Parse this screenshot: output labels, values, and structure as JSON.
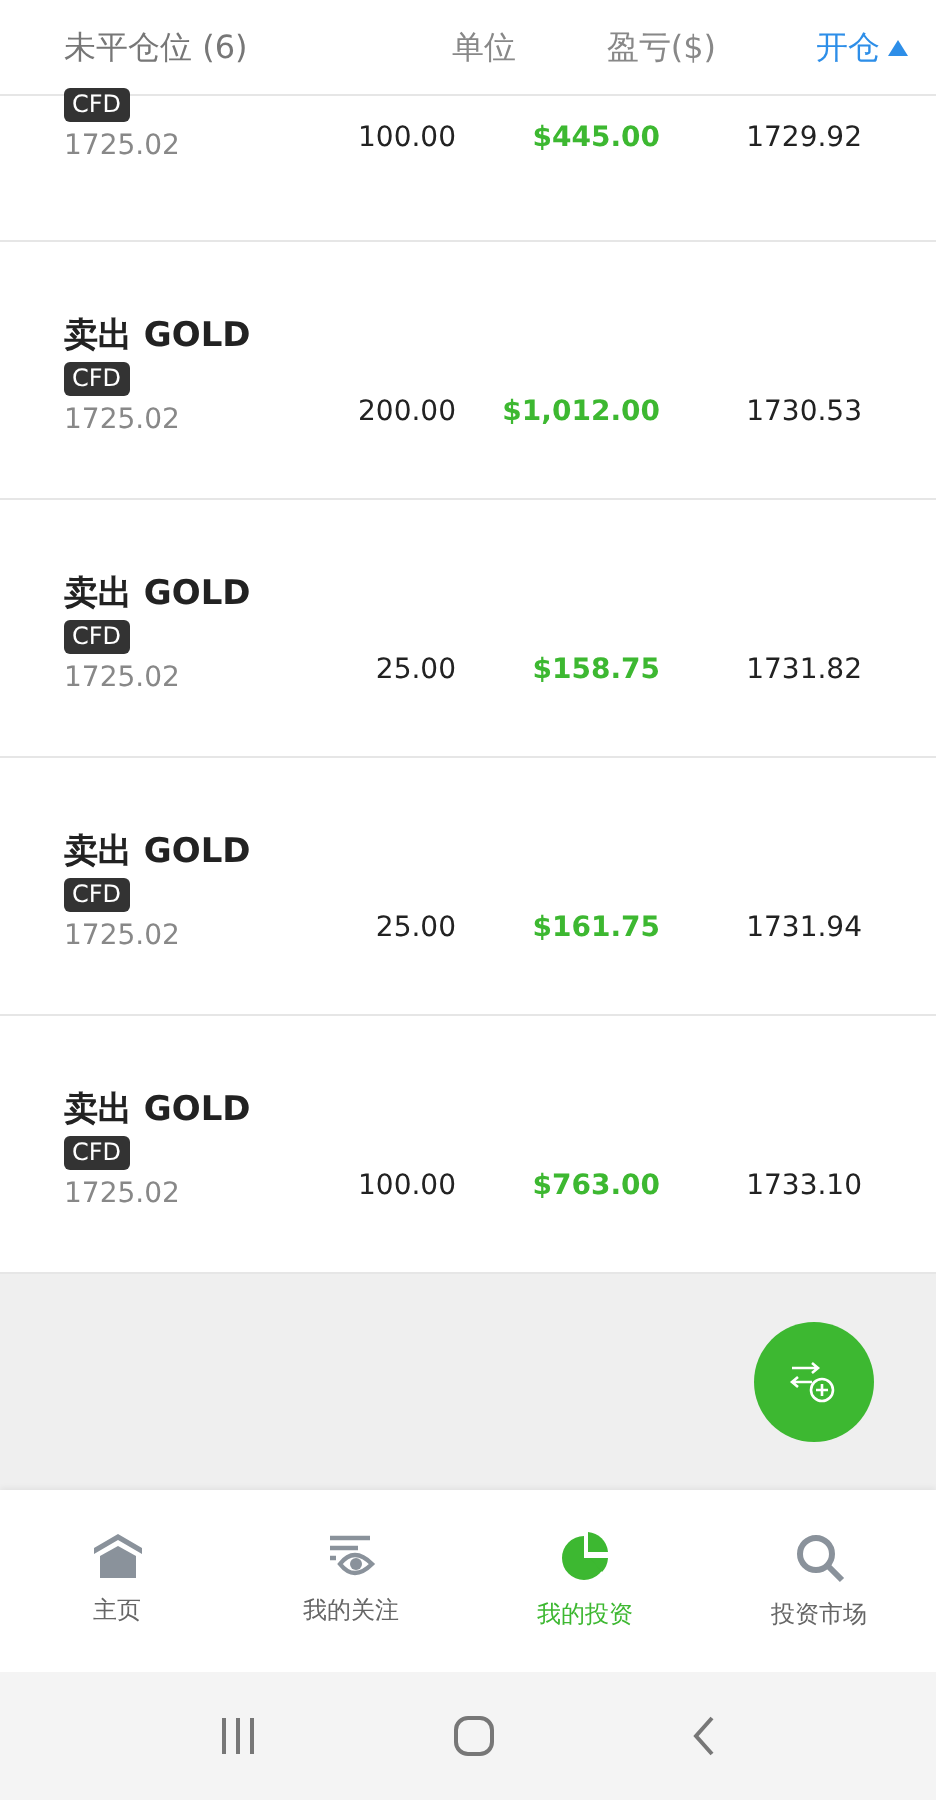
{
  "header": {
    "title": "未平仓位 (6)",
    "columns": [
      {
        "label": "单位",
        "selected": false
      },
      {
        "label": "盈亏($)",
        "selected": false
      },
      {
        "label": "开仓",
        "selected": true
      }
    ]
  },
  "positions": [
    {
      "badge": "CFD",
      "price": "1725.02",
      "units": "100.00",
      "pnl": "$445.00",
      "open": "1729.92"
    },
    {
      "title": "卖出 GOLD",
      "badge": "CFD",
      "price": "1725.02",
      "units": "200.00",
      "pnl": "$1,012.00",
      "open": "1730.53"
    },
    {
      "title": "卖出 GOLD",
      "badge": "CFD",
      "price": "1725.02",
      "units": "25.00",
      "pnl": "$158.75",
      "open": "1731.82"
    },
    {
      "title": "卖出 GOLD",
      "badge": "CFD",
      "price": "1725.02",
      "units": "25.00",
      "pnl": "$161.75",
      "open": "1731.94"
    },
    {
      "title": "卖出 GOLD",
      "badge": "CFD",
      "price": "1725.02",
      "units": "100.00",
      "pnl": "$763.00",
      "open": "1733.10"
    }
  ],
  "nav": [
    {
      "kind": "home",
      "label": "主页",
      "selected": false
    },
    {
      "kind": "watch",
      "label": "我的关注",
      "selected": false
    },
    {
      "kind": "portfolio",
      "label": "我的投资",
      "selected": true
    },
    {
      "kind": "market",
      "label": "投资市场",
      "selected": false
    }
  ]
}
